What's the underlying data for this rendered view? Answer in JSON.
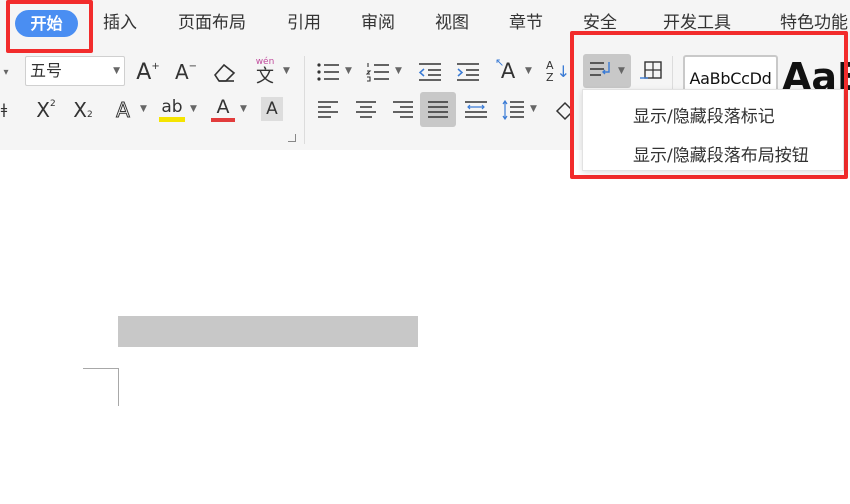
{
  "tabs": {
    "home": "开始",
    "insert": "插入",
    "page_layout": "页面布局",
    "references": "引用",
    "review": "审阅",
    "view": "视图",
    "chapter": "章节",
    "security": "安全",
    "developer": "开发工具",
    "special": "特色功能"
  },
  "toolbar": {
    "font_size": "五号",
    "phonetic_glyph": "wén",
    "highlight_color": "#f5e400",
    "font_color": "#e23c3c"
  },
  "styles": {
    "normal_preview": "AaBbCcDd",
    "heading_preview": "AaB"
  },
  "dropdown_menu": {
    "items": [
      "显示/隐藏段落标记",
      "显示/隐藏段落布局按钮"
    ]
  },
  "colors": {
    "active_tab": "#4a8ef2",
    "annotation": "#f22c2c"
  }
}
